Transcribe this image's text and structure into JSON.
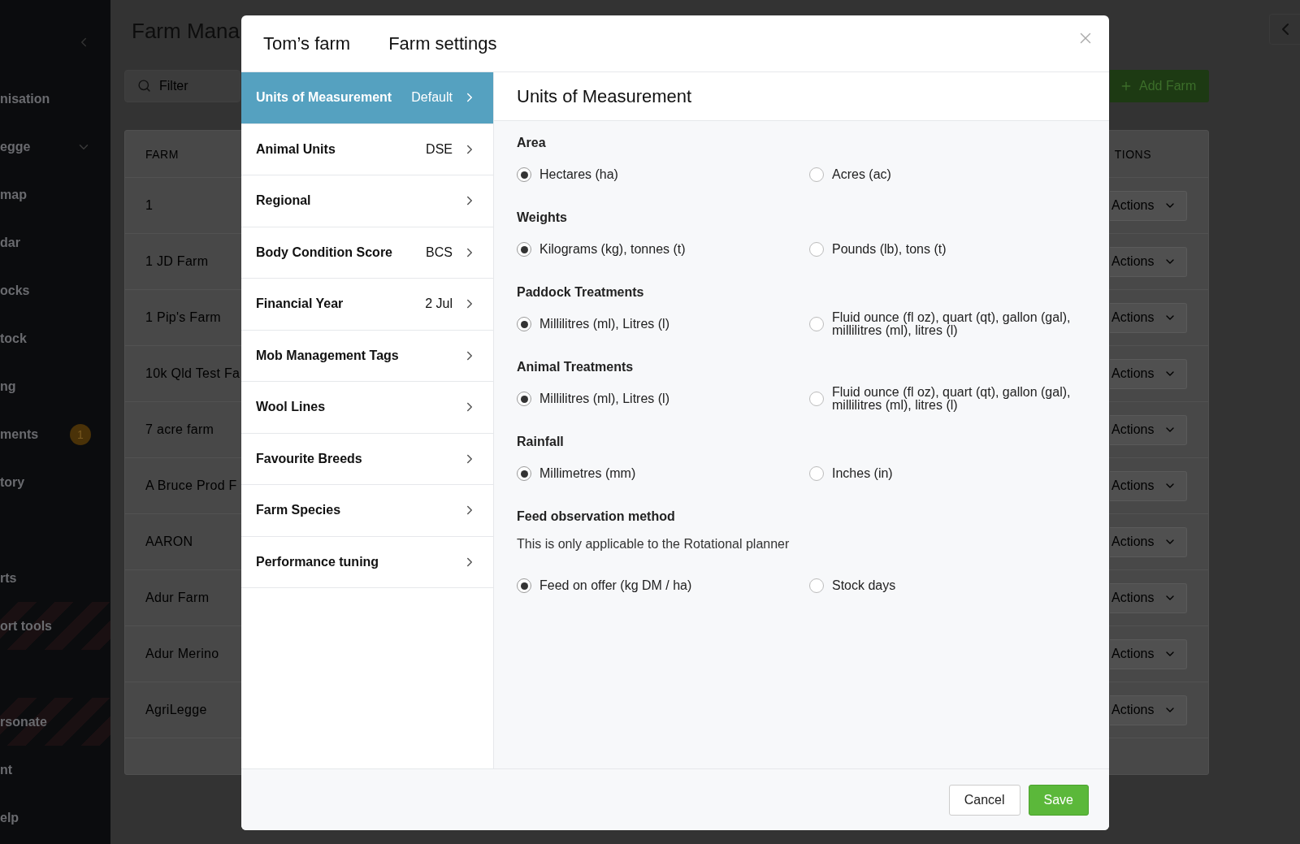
{
  "sidebar": {
    "sections": [
      [
        {
          "label": "nisation",
          "kind": "link"
        },
        {
          "label": "egge",
          "kind": "group"
        },
        {
          "label": "map",
          "kind": "link"
        },
        {
          "label": "dar",
          "kind": "link"
        },
        {
          "label": "ocks",
          "kind": "link"
        },
        {
          "label": "tock",
          "kind": "link"
        },
        {
          "label": "ng",
          "kind": "link"
        },
        {
          "label": "ments",
          "kind": "link",
          "badge": "1"
        },
        {
          "label": "tory",
          "kind": "link"
        }
      ],
      [
        {
          "label": "rts",
          "kind": "link"
        },
        {
          "label": "ort tools",
          "kind": "admin"
        }
      ],
      [
        {
          "label": "rsonate",
          "kind": "admin"
        },
        {
          "label": "nt",
          "kind": "link"
        },
        {
          "label": "elp",
          "kind": "link"
        }
      ]
    ]
  },
  "page": {
    "title": "Farm Mana",
    "filter": {
      "placeholder": "Filter"
    },
    "add_button": "Add Farm",
    "table": {
      "columns": [
        "FARM",
        "TIONS"
      ],
      "rows": [
        {
          "farm": "1",
          "action": "Actions"
        },
        {
          "farm": "1 JD Farm",
          "action": "Actions"
        },
        {
          "farm": "1 Pip's Farm",
          "action": "Actions"
        },
        {
          "farm": "10k Qld Test Fa",
          "action": "Actions"
        },
        {
          "farm": "7 acre farm",
          "action": "Actions"
        },
        {
          "farm": "A Bruce Prod F",
          "action": "Actions"
        },
        {
          "farm": "AARON",
          "action": "Actions"
        },
        {
          "farm": "Adur Farm",
          "action": "Actions"
        },
        {
          "farm": "Adur Merino",
          "action": "Actions"
        },
        {
          "farm": "AgriLegge",
          "action": "Actions"
        }
      ]
    }
  },
  "modal": {
    "title": "Tom’s farm",
    "subtitle": "Farm settings",
    "nav": [
      {
        "label": "Units of Measurement",
        "value": "Default",
        "selected": true
      },
      {
        "label": "Animal Units",
        "value": "DSE",
        "selected": false
      },
      {
        "label": "Regional",
        "selected": false
      },
      {
        "label": "Body Condition Score",
        "value": "BCS",
        "selected": false
      },
      {
        "label": "Financial Year",
        "value": "2 Jul",
        "selected": false
      },
      {
        "label": "Mob Management Tags",
        "selected": false
      },
      {
        "label": "Wool Lines",
        "selected": false
      },
      {
        "label": "Favourite Breeds",
        "selected": false
      },
      {
        "label": "Farm Species",
        "selected": false
      },
      {
        "label": "Performance tuning",
        "selected": false
      }
    ],
    "panel_title": "Units of Measurement",
    "sections": [
      {
        "label": "Area",
        "options": [
          {
            "label": "Hectares (ha)",
            "selected": true
          },
          {
            "label": "Acres (ac)",
            "selected": false
          }
        ]
      },
      {
        "label": "Weights",
        "options": [
          {
            "label": "Kilograms (kg), tonnes (t)",
            "selected": true
          },
          {
            "label": "Pounds (lb), tons (t)",
            "selected": false
          }
        ]
      },
      {
        "label": "Paddock Treatments",
        "options": [
          {
            "label": "Millilitres (ml), Litres (l)",
            "selected": true
          },
          {
            "label": "Fluid ounce (fl oz), quart (qt), gallon (gal), millilitres (ml), litres (l)",
            "selected": false
          }
        ]
      },
      {
        "label": "Animal Treatments",
        "options": [
          {
            "label": "Millilitres (ml), Litres (l)",
            "selected": true
          },
          {
            "label": "Fluid ounce (fl oz), quart (qt), gallon (gal), millilitres (ml), litres (l)",
            "selected": false
          }
        ]
      },
      {
        "label": "Rainfall",
        "options": [
          {
            "label": "Millimetres (mm)",
            "selected": true
          },
          {
            "label": "Inches (in)",
            "selected": false
          }
        ]
      },
      {
        "label": "Feed observation method",
        "note": "This is only applicable to the Rotational planner",
        "options": [
          {
            "label": "Feed on offer (kg DM / ha)",
            "selected": true
          },
          {
            "label": "Stock days",
            "selected": false
          }
        ]
      }
    ],
    "cancel": "Cancel",
    "save": "Save"
  }
}
